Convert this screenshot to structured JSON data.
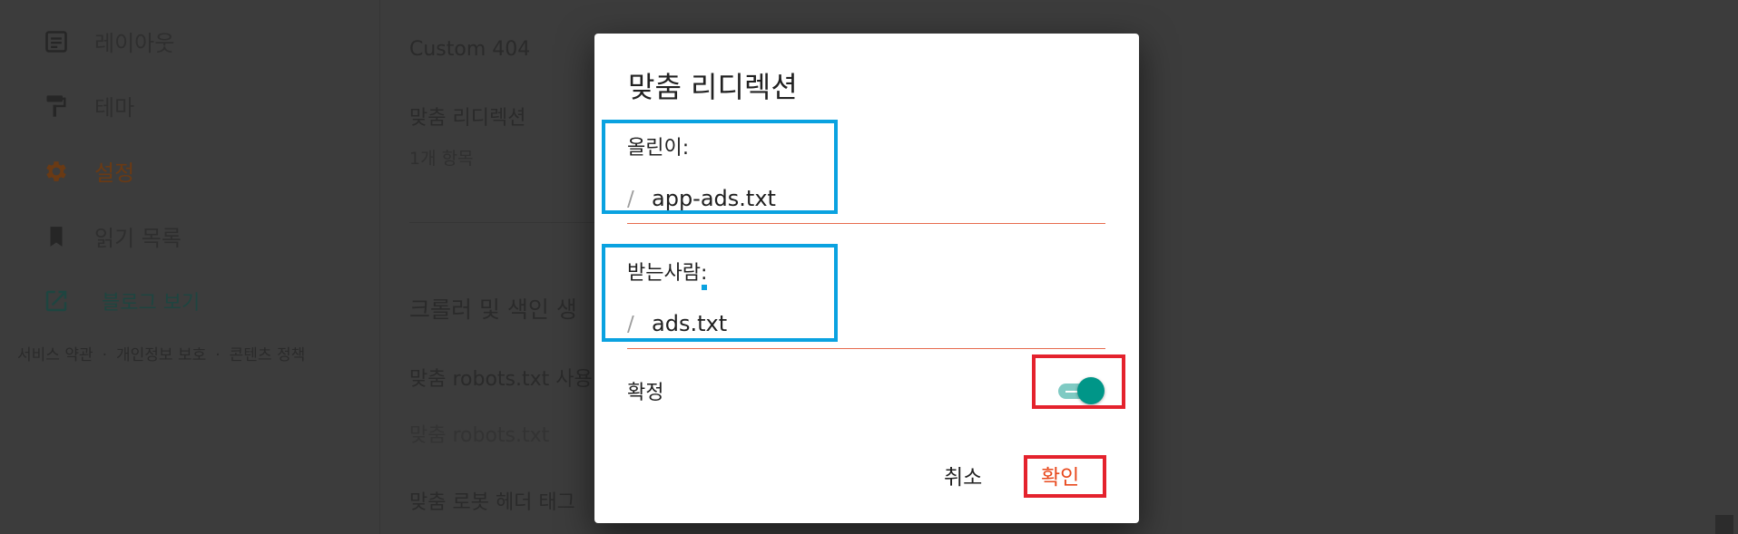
{
  "sidebar": {
    "items": [
      {
        "label": "레이아웃",
        "icon": "layout-icon"
      },
      {
        "label": "테마",
        "icon": "paint-roller-icon"
      },
      {
        "label": "설정",
        "icon": "gear-icon"
      },
      {
        "label": "읽기 목록",
        "icon": "bookmark-icon"
      }
    ],
    "view_blog": {
      "label": "블로그 보기",
      "icon": "open-in-new-icon"
    },
    "footer": {
      "terms": "서비스 약관",
      "privacy": "개인정보 보호",
      "content_policy": "콘텐츠 정책",
      "separator": "·"
    }
  },
  "content": {
    "custom_404": "Custom 404",
    "custom_redirects": "맞춤 리디렉션",
    "redirect_count": "1개 항목",
    "crawler_section": "크롤러 및 색인 생",
    "custom_robots_enable": "맞춤 robots.txt 사용",
    "custom_robots": "맞춤 robots.txt",
    "custom_robot_header": "맞춤 로봇 헤더 태그"
  },
  "dialog": {
    "title": "맞춤 리디렉션",
    "from": {
      "label": "올린이:",
      "prefix": "/",
      "value": "app-ads.txt"
    },
    "to": {
      "label": "받는사람:",
      "prefix": "/",
      "value": "ads.txt"
    },
    "permanent": {
      "label": "확정",
      "checked": true
    },
    "cancel_label": "취소",
    "ok_label": "확인"
  },
  "colors": {
    "accent": "#e8491d",
    "toggle_on": "#009688",
    "annotation_blue": "#0aa2e0",
    "annotation_red": "#e4222d",
    "overlay": "#3c3c3c"
  }
}
